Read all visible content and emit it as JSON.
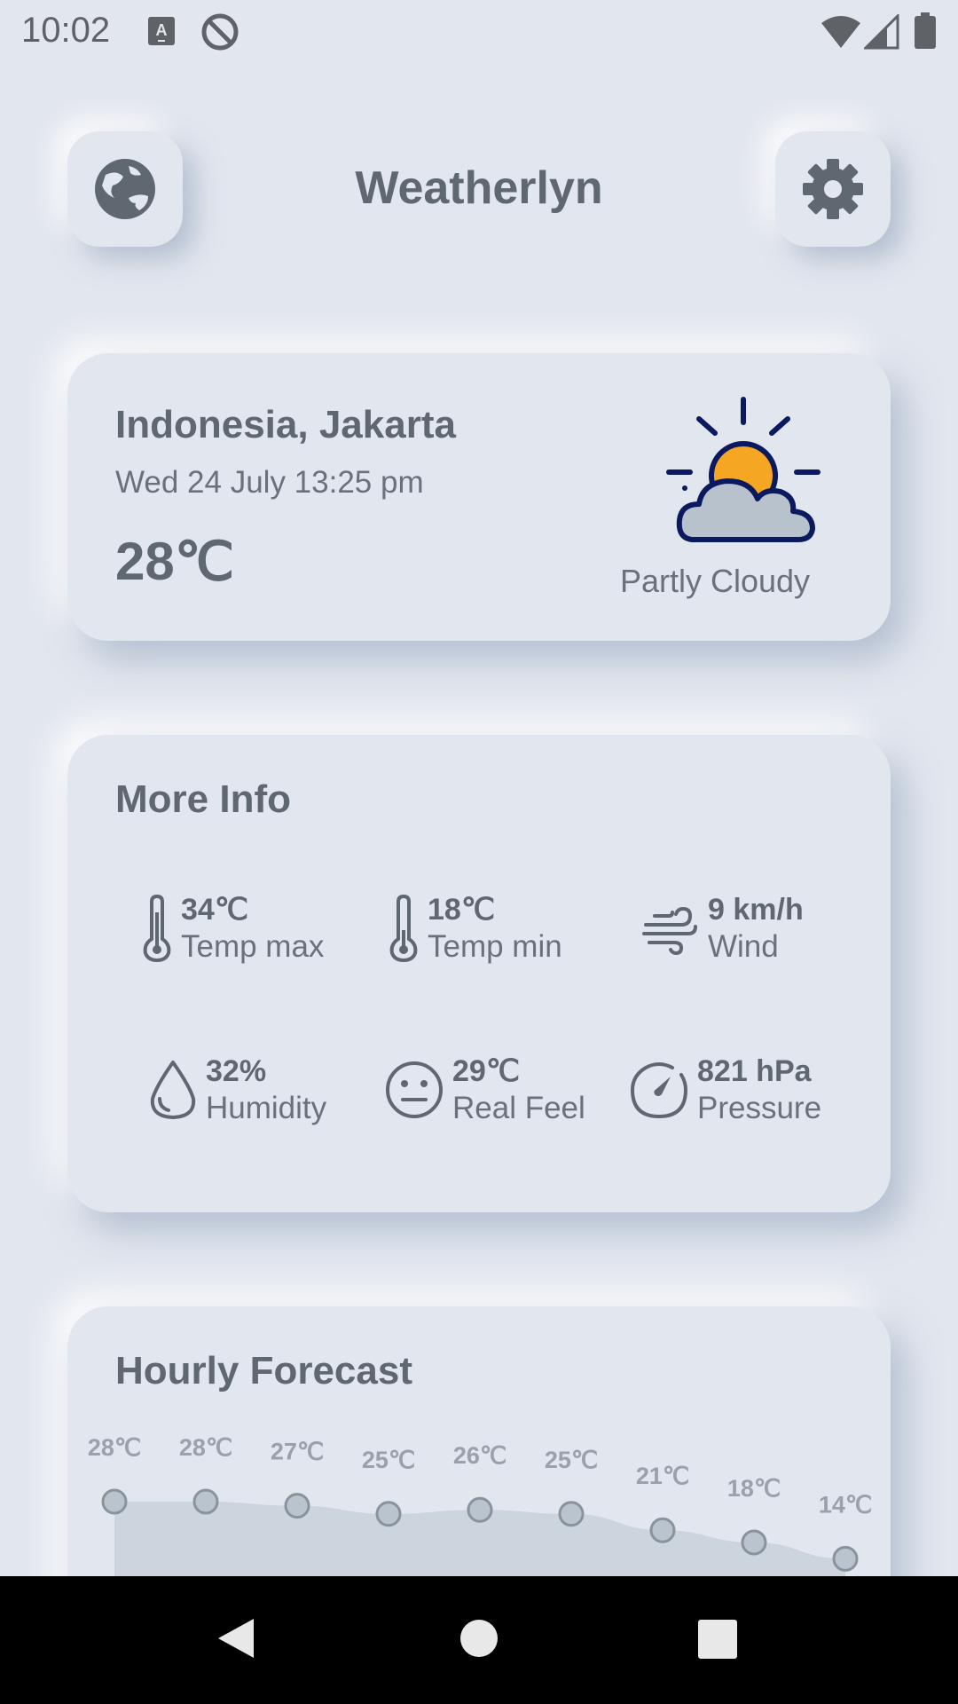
{
  "status_bar": {
    "time": "10:02",
    "icons": [
      "keyboard-a-icon",
      "do-not-disturb-icon",
      "wifi-icon",
      "signal-icon",
      "battery-icon"
    ]
  },
  "header": {
    "title": "Weatherlyn",
    "left_icon": "globe-icon",
    "right_icon": "gear-icon"
  },
  "current": {
    "location": "Indonesia, Jakarta",
    "datetime": "Wed 24 July 13:25 pm",
    "temperature": "28℃",
    "condition": "Partly Cloudy",
    "condition_icon": "partly-cloudy-icon"
  },
  "more_info": {
    "title": "More Info",
    "items": [
      {
        "value": "34℃",
        "label": "Temp max",
        "icon": "thermometer-icon"
      },
      {
        "value": "18℃",
        "label": "Temp min",
        "icon": "thermometer-icon"
      },
      {
        "value": "9 km/h",
        "label": "Wind",
        "icon": "wind-icon"
      },
      {
        "value": "32%",
        "label": "Humidity",
        "icon": "droplet-icon"
      },
      {
        "value": "29℃",
        "label": "Real Feel",
        "icon": "neutral-face-icon"
      },
      {
        "value": "821 hPa",
        "label": "Pressure",
        "icon": "gauge-icon"
      }
    ]
  },
  "hourly": {
    "title": "Hourly Forecast",
    "temps": [
      28,
      28,
      27,
      25,
      26,
      25,
      21,
      18,
      14
    ],
    "labels": [
      "28℃",
      "28℃",
      "27℃",
      "25℃",
      "26℃",
      "25℃",
      "21℃",
      "18℃",
      "14℃"
    ]
  },
  "nav_bar": {
    "icons": [
      "back-icon",
      "home-icon",
      "recents-icon"
    ]
  },
  "colors": {
    "background": "#e2e6ee",
    "text": "#5f6770",
    "icon": "#5f6770",
    "sun": "#f5a623",
    "cloud": "#b7c2cc",
    "outline": "#0b1a5e"
  }
}
